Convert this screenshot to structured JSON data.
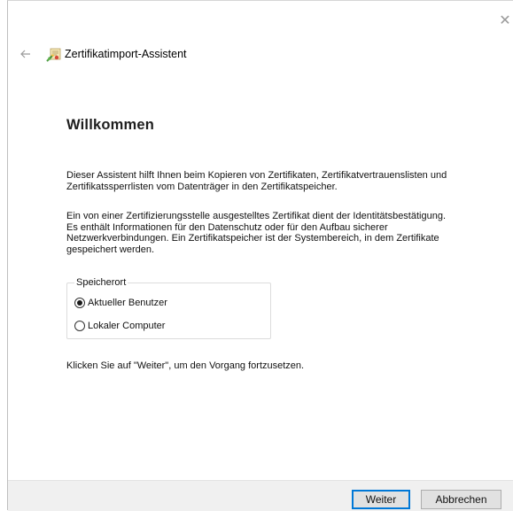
{
  "window": {
    "title": "Zertifikatimport-Assistent",
    "close_icon": "close-icon",
    "back_icon": "back-arrow-icon",
    "wizard_icon": "certificate-wizard-icon"
  },
  "page": {
    "heading": "Willkommen",
    "intro_lines": [
      "Dieser Assistent hilft Ihnen beim Kopieren von Zertifikaten, Zertifikatvertrauenslisten und",
      "Zertifikatssperrlisten vom Datenträger in den Zertifikatspeicher."
    ],
    "info_lines": [
      "Ein von einer Zertifizierungsstelle ausgestelltes Zertifikat dient der Identitätsbestätigung.",
      "Es enthält Informationen für den Datenschutz oder für den Aufbau sicherer",
      "Netzwerkverbindungen. Ein Zertifikatspeicher ist der Systembereich, in dem Zertifikate",
      "gespeichert werden."
    ],
    "store_location": {
      "legend": "Speicherort",
      "options": [
        {
          "label": "Aktueller Benutzer",
          "selected": true
        },
        {
          "label": "Lokaler Computer",
          "selected": false
        }
      ]
    },
    "continue_hint": "Klicken Sie auf \"Weiter\", um den Vorgang fortzusetzen."
  },
  "footer": {
    "next_label": "Weiter",
    "cancel_label": "Abbrechen"
  },
  "colors": {
    "accent_border": "#0078d7",
    "footer_bg": "#f0f0f0",
    "button_bg": "#e1e1e1"
  }
}
